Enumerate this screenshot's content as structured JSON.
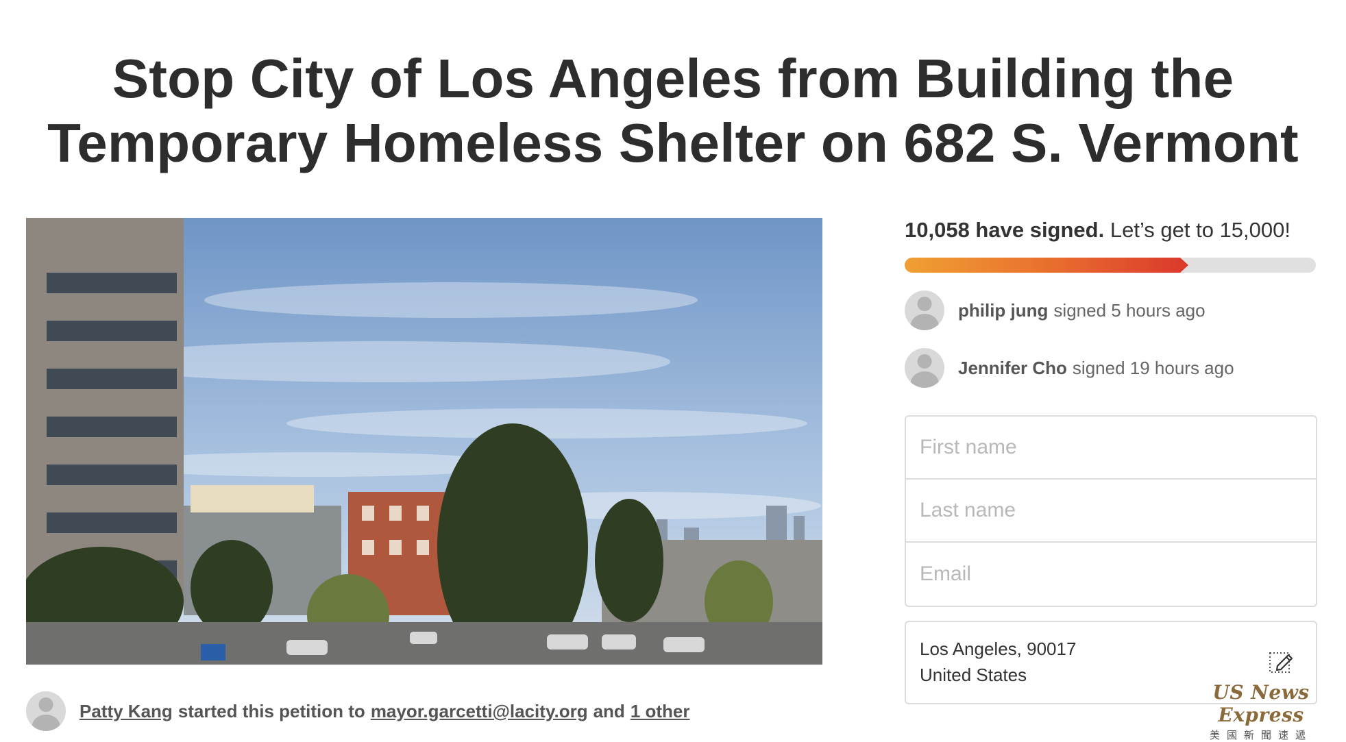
{
  "petition": {
    "title_line1": "Stop City of Los Angeles from Building the",
    "title_line2": "Temporary Homeless Shelter on 682 S. Vermont"
  },
  "image": {
    "icon": "street-view-photo"
  },
  "starter": {
    "name": "Patty Kang",
    "text_started": "started this petition to",
    "recipient": "mayor.garcetti@lacity.org",
    "and_text": "and",
    "other_link": "1 other"
  },
  "signatures": {
    "count_text": "10,058 have signed.",
    "goal_text": "Let’s get to 15,000!",
    "progress_fraction": 0.67,
    "progress_colors": [
      "#f0a033",
      "#dc3b2c"
    ]
  },
  "recent_signers": [
    {
      "name": "philip jung",
      "text": "signed 5 hours ago"
    },
    {
      "name": "Jennifer Cho",
      "text": "signed 19 hours ago"
    }
  ],
  "form": {
    "first_name_placeholder": "First name",
    "last_name_placeholder": "Last name",
    "email_placeholder": "Email"
  },
  "location": {
    "line1": "Los Angeles, 90017",
    "line2": "United States",
    "edit_icon": "pencil-edit-icon"
  },
  "watermark": {
    "english": "US News Express",
    "chinese": "美國新聞速遞"
  }
}
